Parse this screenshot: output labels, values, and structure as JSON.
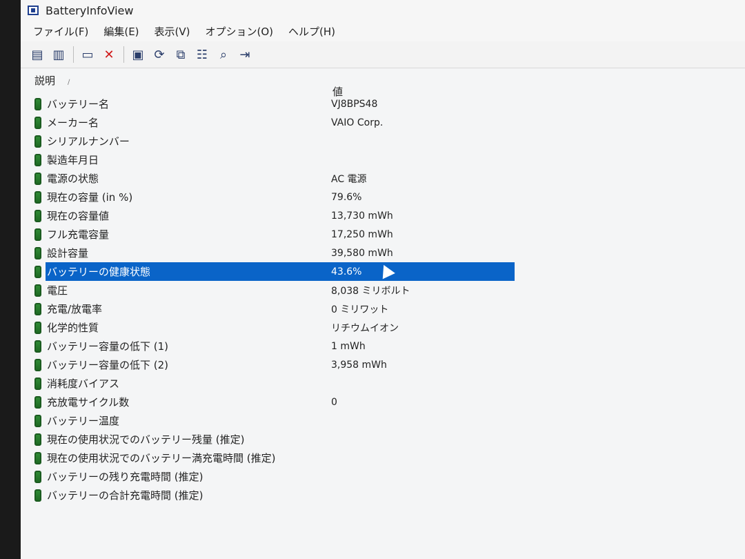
{
  "window": {
    "title": "BatteryInfoView"
  },
  "menu": [
    "ファイル(F)",
    "編集(E)",
    "表示(V)",
    "オプション(O)",
    "ヘルプ(H)"
  ],
  "toolbar": {
    "icons": [
      "view-list-icon",
      "view-report-icon",
      "screen-icon",
      "delete-icon",
      "save-icon",
      "refresh-icon",
      "copy-icon",
      "properties-icon",
      "search-icon",
      "exit-icon"
    ]
  },
  "table": {
    "headers": {
      "name": "説明",
      "value": "値"
    },
    "rows": [
      {
        "name": "バッテリー名",
        "value": "VJ8BPS48"
      },
      {
        "name": "メーカー名",
        "value": "VAIO Corp."
      },
      {
        "name": "シリアルナンバー",
        "value": ""
      },
      {
        "name": "製造年月日",
        "value": ""
      },
      {
        "name": "電源の状態",
        "value": "AC 電源"
      },
      {
        "name": "現在の容量 (in %)",
        "value": "79.6%"
      },
      {
        "name": "現在の容量値",
        "value": "13,730 mWh"
      },
      {
        "name": "フル充電容量",
        "value": "17,250 mWh"
      },
      {
        "name": "設計容量",
        "value": "39,580 mWh"
      },
      {
        "name": "バッテリーの健康状態",
        "value": "43.6%"
      },
      {
        "name": "電圧",
        "value": "8,038 ミリボルト"
      },
      {
        "name": "充電/放電率",
        "value": "0 ミリワット"
      },
      {
        "name": "化学的性質",
        "value": "リチウムイオン"
      },
      {
        "name": "バッテリー容量の低下 (1)",
        "value": "1 mWh"
      },
      {
        "name": "バッテリー容量の低下 (2)",
        "value": "3,958 mWh"
      },
      {
        "name": "消耗度バイアス",
        "value": ""
      },
      {
        "name": "充放電サイクル数",
        "value": "0"
      },
      {
        "name": "バッテリー温度",
        "value": ""
      },
      {
        "name": "現在の使用状況でのバッテリー残量 (推定)",
        "value": ""
      },
      {
        "name": "現在の使用状況でのバッテリー満充電時間 (推定)",
        "value": ""
      },
      {
        "name": "バッテリーの残り充電時間 (推定)",
        "value": ""
      },
      {
        "name": "バッテリーの合計充電時間 (推定)",
        "value": ""
      }
    ],
    "selected_index": 9
  }
}
